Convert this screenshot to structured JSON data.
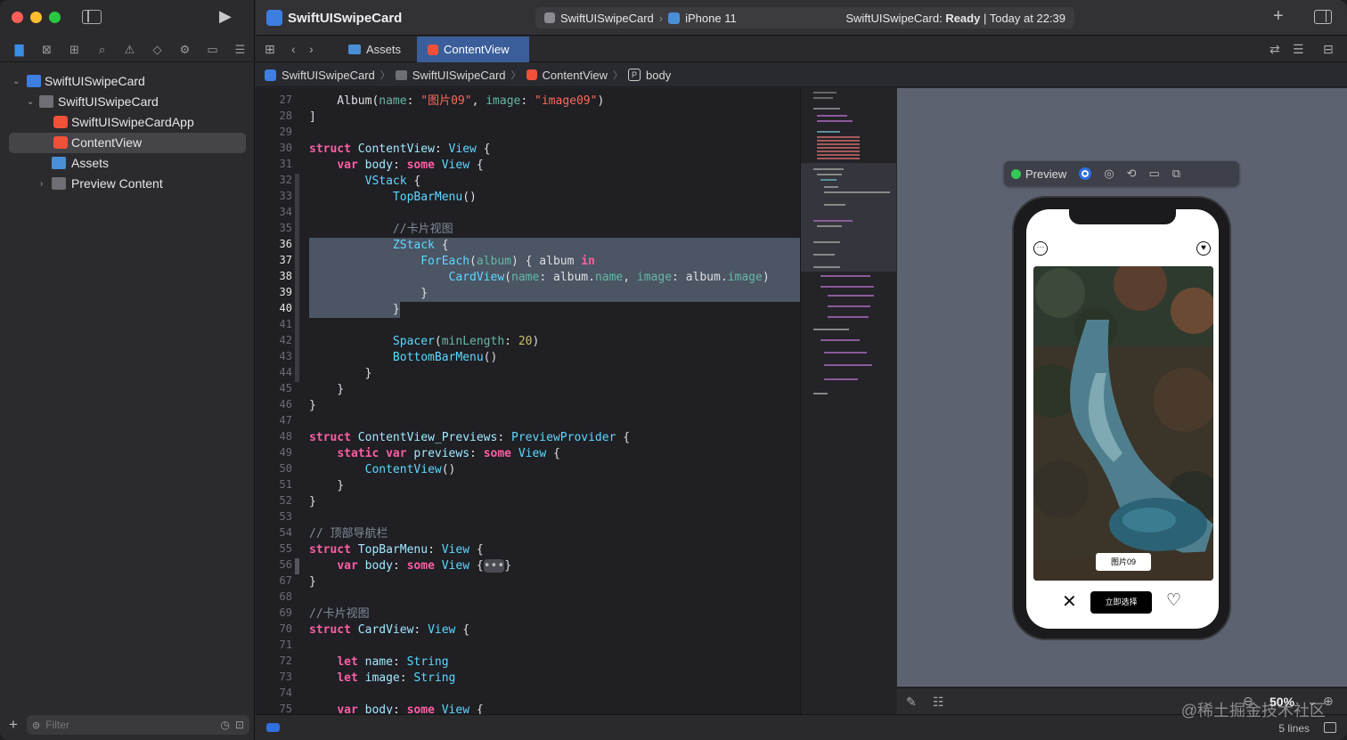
{
  "window": {
    "project_title": "SwiftUISwipeCard",
    "scheme_app": "SwiftUISwipeCard",
    "scheme_device": "iPhone 11",
    "status_prefix": "SwiftUISwipeCard: ",
    "status_state": "Ready",
    "status_time": " | Today at 22:39"
  },
  "navigator": {
    "items": [
      {
        "label": "SwiftUISwipeCard",
        "icon": "project-icon",
        "indent": 0,
        "expanded": true
      },
      {
        "label": "SwiftUISwipeCard",
        "icon": "folder-icon",
        "indent": 1,
        "expanded": true
      },
      {
        "label": "SwiftUISwipeCardApp",
        "icon": "swift-file-icon",
        "indent": 2
      },
      {
        "label": "ContentView",
        "icon": "swift-file-icon",
        "indent": 2,
        "selected": true
      },
      {
        "label": "Assets",
        "icon": "asset-catalog-icon",
        "indent": 2
      },
      {
        "label": "Preview Content",
        "icon": "folder-icon",
        "indent": 2,
        "expanded": false
      }
    ],
    "filter_placeholder": "Filter"
  },
  "tabs": [
    {
      "label": "Assets",
      "active": false
    },
    {
      "label": "ContentView",
      "active": true
    }
  ],
  "jump_bar": [
    "SwiftUISwipeCard",
    "SwiftUISwipeCard",
    "ContentView",
    "body"
  ],
  "editor": {
    "line_numbers": [
      "27",
      "28",
      "29",
      "30",
      "31",
      "32",
      "33",
      "34",
      "35",
      "36",
      "37",
      "38",
      "39",
      "40",
      "41",
      "42",
      "43",
      "44",
      "45",
      "46",
      "47",
      "48",
      "49",
      "50",
      "51",
      "52",
      "53",
      "54",
      "55",
      "56",
      "67",
      "68",
      "69",
      "70",
      "71",
      "72",
      "73",
      "74",
      "75"
    ],
    "current_lines": [
      "36",
      "37",
      "38",
      "39",
      "40"
    ]
  },
  "preview": {
    "label": "Preview",
    "card_caption": "图片09",
    "select_button": "立即选择",
    "zoom": "50%"
  },
  "statusbar": {
    "lines": "5 lines"
  },
  "watermark": "@稀土掘金技术社区",
  "colors": {
    "accent": "#3a5e9a",
    "selection": "#4b5564",
    "keyword": "#fc5fa3",
    "string": "#fc6a5d",
    "type": "#5dd8ff"
  }
}
